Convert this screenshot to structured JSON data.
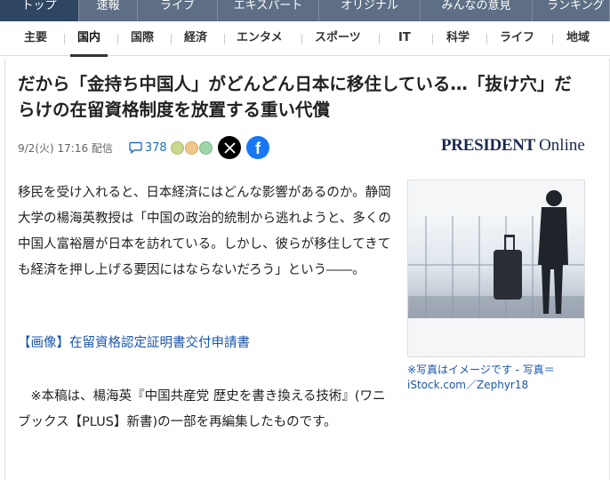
{
  "topnav": {
    "tabs": [
      {
        "label": "トップ",
        "active": true
      },
      {
        "label": "速報",
        "active": false
      },
      {
        "label": "ライブ",
        "active": false
      },
      {
        "label": "エキスパート",
        "active": false
      },
      {
        "label": "オリジナル",
        "active": false
      },
      {
        "label": "みんなの意見",
        "active": false
      },
      {
        "label": "ランキング",
        "active": false
      }
    ]
  },
  "subnav": {
    "items": [
      {
        "label": "主要",
        "active": false
      },
      {
        "label": "国内",
        "active": true
      },
      {
        "label": "国際",
        "active": false
      },
      {
        "label": "経済",
        "active": false
      },
      {
        "label": "エンタメ",
        "active": false
      },
      {
        "label": "スポーツ",
        "active": false
      },
      {
        "label": "IT",
        "active": false
      },
      {
        "label": "科学",
        "active": false
      },
      {
        "label": "ライフ",
        "active": false
      },
      {
        "label": "地域",
        "active": false
      }
    ]
  },
  "article": {
    "headline": "だから「金持ち中国人」がどんどん日本に移住している…「抜け穴」だらけの在留資格制度を放置する重い代償",
    "date": "9/2(火) 17:16 配信",
    "comment_count": "378",
    "publisher_logo_main": "PRESIDENT",
    "publisher_logo_sub": "Online",
    "body": "移民を受け入れると、日本経済にはどんな影響があるのか。静岡大学の楊海英教授は「中国の政治的統制から逃れようと、多くの中国人富裕層が日本を訪れている。しかし、彼らが移住してきても経済を押し上げる要因にはならないだろう」という――。",
    "image_link": "【画像】在留資格認定証明書交付申請書",
    "note": "　※本稿は、楊海英『中国共産党 歴史を書き換える技術』(ワニブックス【PLUS】新書)の一部を再編集したものです。",
    "caption": "※写真はイメージです - 写真＝iStock.com／Zephyr18"
  },
  "colors": {
    "topnav_bg": "#5e6f85",
    "topnav_active": "#2f4663",
    "link": "#1a55b0",
    "comment": "#1a73c9",
    "facebook": "#1877f2"
  },
  "icons": {
    "comment": "comment-bubble-icon",
    "reactions": "reaction-faces-icon",
    "x": "x-logo-icon",
    "facebook": "facebook-logo-icon"
  }
}
